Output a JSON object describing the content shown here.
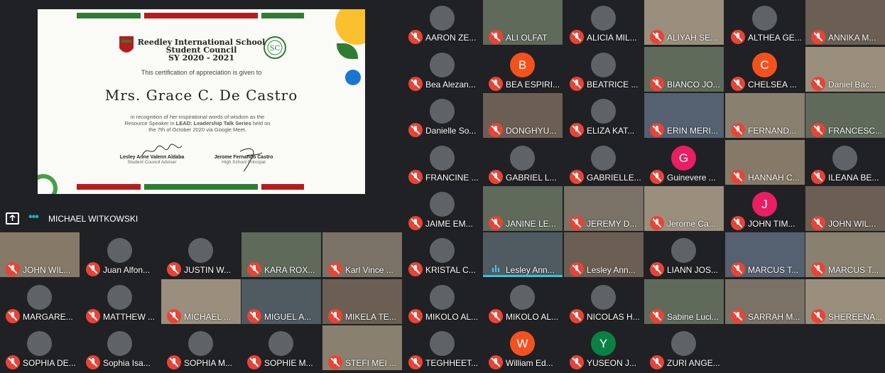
{
  "emoji_bar": {
    "icons": [
      "party-popper-icon",
      "confetti-icon"
    ]
  },
  "presentation": {
    "presenter_name": "MICHAEL WITKOWSKI",
    "certificate": {
      "school": "Reedley International School",
      "council": "Student Council",
      "year": "SY 2020 - 2021",
      "intro": "This certification of appreciation is given to",
      "recipient": "Mrs. Grace C. De Castro",
      "desc1": "in recognition of her inspirational words of wisdom as the",
      "desc2a": "Resource Speaker in ",
      "desc2b": "LEAD: Leadership Talk Series",
      "desc2c": " held on",
      "desc3": "the 7th of October 2020 via Google Meet.",
      "signer1_name": "Lesley Anne Valenn Aldaba",
      "signer1_role": "Student Council Adviser",
      "signer2_name": "Jerome Fernando Castro",
      "signer2_role": "High School Principal",
      "seal_text": "SC"
    }
  },
  "participants": [
    {
      "name": "AARON ZE...",
      "avatar": "",
      "color": ""
    },
    {
      "name": "ALI OLFAT",
      "avatar": "",
      "color": ""
    },
    {
      "name": "ALICIA MIL...",
      "avatar": "",
      "color": ""
    },
    {
      "name": "ALIYAH SE...",
      "avatar": "",
      "color": ""
    },
    {
      "name": "ALTHEA GE...",
      "avatar": "",
      "color": ""
    },
    {
      "name": "ANNIKA M...",
      "avatar": "",
      "color": ""
    },
    {
      "name": "Bea Alezan...",
      "avatar": "",
      "color": ""
    },
    {
      "name": "BEA ESPIRI...",
      "avatar": "B",
      "color": "#f4511e"
    },
    {
      "name": "BEATRICE ...",
      "avatar": "",
      "color": ""
    },
    {
      "name": "BIANCO JO...",
      "avatar": "",
      "color": ""
    },
    {
      "name": "CHELSEA ...",
      "avatar": "C",
      "color": "#f4511e"
    },
    {
      "name": "Daniel Bac...",
      "avatar": "",
      "color": ""
    },
    {
      "name": "Danielle So...",
      "avatar": "",
      "color": ""
    },
    {
      "name": "DONGHYU...",
      "avatar": "",
      "color": ""
    },
    {
      "name": "ELIZA KAT...",
      "avatar": "",
      "color": ""
    },
    {
      "name": "ERIN MERI...",
      "avatar": "",
      "color": ""
    },
    {
      "name": "FERNAND...",
      "avatar": "",
      "color": ""
    },
    {
      "name": "FRANCESC...",
      "avatar": "",
      "color": ""
    },
    {
      "name": "FRANCINE ...",
      "avatar": "",
      "color": ""
    },
    {
      "name": "GABRIEL L...",
      "avatar": "",
      "color": ""
    },
    {
      "name": "GABRIELLE...",
      "avatar": "",
      "color": ""
    },
    {
      "name": "Guinevere ...",
      "avatar": "G",
      "color": "#e91e63"
    },
    {
      "name": "HANNAH C...",
      "avatar": "",
      "color": ""
    },
    {
      "name": "ILEANA BE...",
      "avatar": "",
      "color": ""
    },
    {
      "name": "JAIME EM...",
      "avatar": "",
      "color": ""
    },
    {
      "name": "JANINE LE...",
      "avatar": "",
      "color": ""
    },
    {
      "name": "JEREMY D...",
      "avatar": "",
      "color": ""
    },
    {
      "name": "Jerome Ca...",
      "avatar": "",
      "color": ""
    },
    {
      "name": "JOHN TIM...",
      "avatar": "J",
      "color": "#e91e63"
    },
    {
      "name": "JOHN WIL...",
      "avatar": "",
      "color": ""
    },
    {
      "name": "JOHN WIL...",
      "avatar": "",
      "color": ""
    },
    {
      "name": "Juan Alfon...",
      "avatar": "",
      "color": ""
    },
    {
      "name": "JUSTIN W...",
      "avatar": "",
      "color": ""
    },
    {
      "name": "KARA ROX...",
      "avatar": "",
      "color": ""
    },
    {
      "name": "Karl Vince ...",
      "avatar": "",
      "color": ""
    },
    {
      "name": "KRISTAL C...",
      "avatar": "",
      "color": ""
    },
    {
      "name": "Lesley Ann...",
      "avatar": "",
      "color": ""
    },
    {
      "name": "Lesley Ann...",
      "avatar": "",
      "color": ""
    },
    {
      "name": "LIANN JOS...",
      "avatar": "",
      "color": ""
    },
    {
      "name": "MARCUS T...",
      "avatar": "",
      "color": ""
    },
    {
      "name": "MARCUS T...",
      "avatar": "",
      "color": ""
    },
    {
      "name": "MARGARE...",
      "avatar": "",
      "color": ""
    },
    {
      "name": "MATTHEW ...",
      "avatar": "",
      "color": ""
    },
    {
      "name": "MICHAEL ...",
      "avatar": "",
      "color": ""
    },
    {
      "name": "MIGUEL A...",
      "avatar": "",
      "color": ""
    },
    {
      "name": "MIKELA TE...",
      "avatar": "",
      "color": ""
    },
    {
      "name": "MIKOLO AL...",
      "avatar": "",
      "color": ""
    },
    {
      "name": "MIKOLO AL...",
      "avatar": "",
      "color": ""
    },
    {
      "name": "NICOLAS H...",
      "avatar": "",
      "color": ""
    },
    {
      "name": "Sabine Luci...",
      "avatar": "",
      "color": ""
    },
    {
      "name": "SARRAH M...",
      "avatar": "",
      "color": ""
    },
    {
      "name": "SHEREENA...",
      "avatar": "",
      "color": ""
    },
    {
      "name": "SOPHIA DE...",
      "avatar": "",
      "color": ""
    },
    {
      "name": "Sophia Isa...",
      "avatar": "",
      "color": ""
    },
    {
      "name": "SOPHIA M...",
      "avatar": "",
      "color": ""
    },
    {
      "name": "SOPHIE M...",
      "avatar": "",
      "color": ""
    },
    {
      "name": "STEFI MEI ...",
      "avatar": "",
      "color": ""
    },
    {
      "name": "TEGHHEET...",
      "avatar": "",
      "color": ""
    },
    {
      "name": "William Ed...",
      "avatar": "W",
      "color": "#f4511e"
    },
    {
      "name": "YUSEON J...",
      "avatar": "Y",
      "color": "#0b8043"
    },
    {
      "name": "ZURI ANGE...",
      "avatar": "",
      "color": ""
    }
  ]
}
